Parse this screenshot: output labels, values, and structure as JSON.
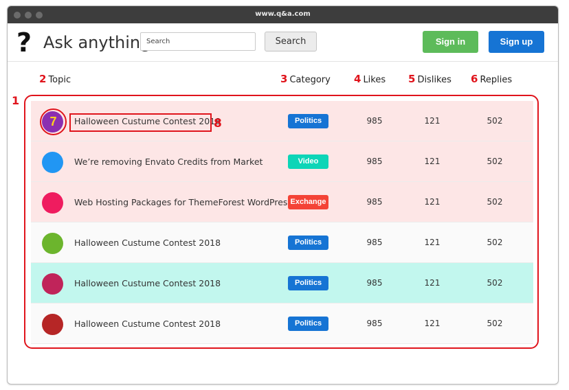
{
  "browser": {
    "url": "www.q&a.com"
  },
  "header": {
    "logo_glyph": "?",
    "brand": "Ask anything",
    "search_placeholder": "Search",
    "search_button": "Search",
    "signin_label": "Sign in",
    "signup_label": "Sign up"
  },
  "annotations": {
    "list": "1",
    "topic": "2",
    "category": "3",
    "likes": "4",
    "dislikes": "5",
    "replies": "6",
    "avatar": "7",
    "title": "8"
  },
  "columns": {
    "topic": "Topic",
    "category": "Category",
    "likes": "Likes",
    "dislikes": "Dislikes",
    "replies": "Replies"
  },
  "colors": {
    "highlight_red": "#e0131b",
    "sign_in": "#5dbb5a",
    "sign_up": "#1674d4"
  },
  "rows": [
    {
      "topic": "Halloween Custume Contest 2018",
      "category": "Politics",
      "category_color": "#1674d4",
      "avatar_color": "#8b2fb0",
      "row_bg": "#fde6e6",
      "likes": "985",
      "dislikes": "121",
      "replies": "502"
    },
    {
      "topic": "We’re removing Envato Credits from Market",
      "category": "Video",
      "category_color": "#0dd5b7",
      "avatar_color": "#2196f3",
      "row_bg": "#fde6e6",
      "likes": "985",
      "dislikes": "121",
      "replies": "502"
    },
    {
      "topic": "Web Hosting Packages for ThemeForest WordPress",
      "category": "Exchange",
      "category_color": "#f44336",
      "avatar_color": "#ef1c5f",
      "row_bg": "#fde6e6",
      "likes": "985",
      "dislikes": "121",
      "replies": "502"
    },
    {
      "topic": "Halloween Custume Contest 2018",
      "category": "Politics",
      "category_color": "#1674d4",
      "avatar_color": "#6cb52d",
      "row_bg": "#fafafa",
      "likes": "985",
      "dislikes": "121",
      "replies": "502"
    },
    {
      "topic": "Halloween Custume Contest 2018",
      "category": "Politics",
      "category_color": "#1674d4",
      "avatar_color": "#c0245a",
      "row_bg": "#c2f7ee",
      "likes": "985",
      "dislikes": "121",
      "replies": "502"
    },
    {
      "topic": "Halloween Custume Contest 2018",
      "category": "Politics",
      "category_color": "#1674d4",
      "avatar_color": "#b62626",
      "row_bg": "#fafafa",
      "likes": "985",
      "dislikes": "121",
      "replies": "502"
    }
  ]
}
